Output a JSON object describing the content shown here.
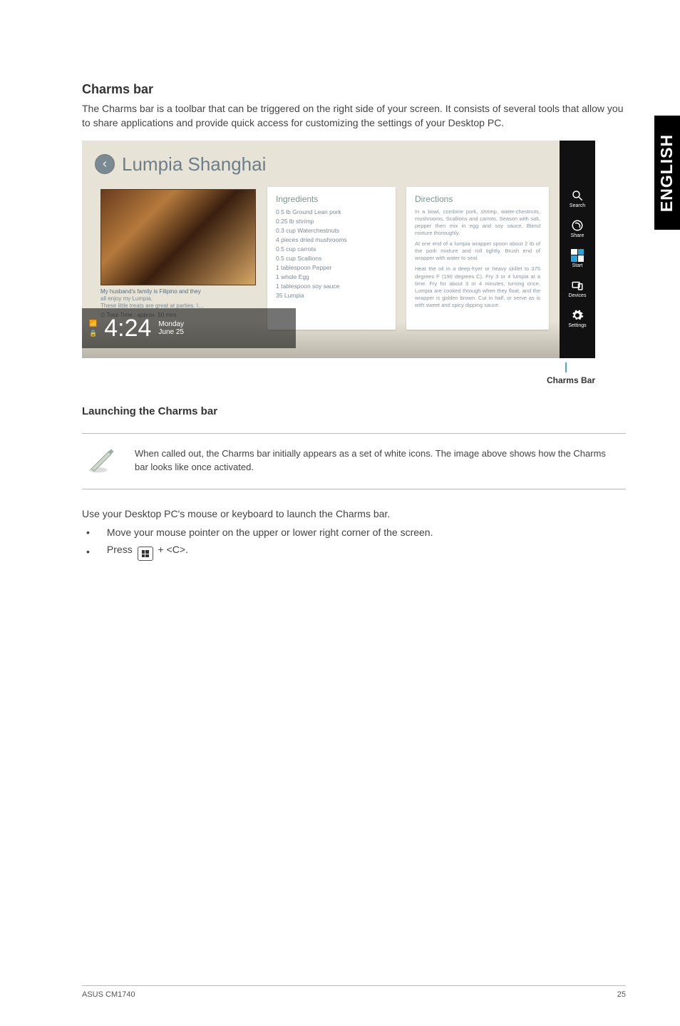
{
  "sideTab": "ENGLISH",
  "heading": "Charms bar",
  "intro": "The Charms bar is a toolbar that can be triggered on the right side of your screen. It consists of several tools that allow you to share applications and provide quick access for customizing the settings of your Desktop PC.",
  "screenshot": {
    "appTitle": "Lumpia Shanghai",
    "caption": {
      "l1": "My husband's family is Filipino and they",
      "l2": "all enjoy my Lumpia.",
      "l3": "These little treats are great at parties. I…",
      "l4": "Total Time : approx. 50 mns"
    },
    "time": "4:24",
    "day": "Monday",
    "date": "June 25",
    "ingredientsTitle": "Ingredients",
    "ingredients": [
      "0.5 lb Ground Lean pork",
      "0.25 lb shrimp",
      "0.3 cup Waterchestnuts",
      "4 pieces dried mushrooms",
      "0.5 cup carrots",
      "0.5 cup Scallions",
      "1 tablespoon Pepper",
      "1 whole Egg",
      "1 tablespoon soy sauce",
      "35 Lumpia"
    ],
    "directionsTitle": "Directions",
    "directions": [
      "In a bowl, combine pork, shrimp, water-chestnuts, mushrooms, Scallions and carrots. Season with salt, pepper then mix in egg and soy sauce. Blend mixture thoroughly.",
      "At one end of a lumpia wrapper spoon about 2 tb of the pork mixture and roll tightly. Brush end of wrapper with water to seal.",
      "Heat the oil in a deep-fryer or heavy skillet to 375 degrees F (190 degrees C). Fry 3 or 4 lumpia at a time. Fry for about 3 or 4 minutes, turning once. Lumpia are cooked through when they float, and the wrapper is golden brown. Cut in half, or serve as is with sweet and spicy dipping sauce."
    ],
    "charms": {
      "search": "Search",
      "share": "Share",
      "start": "Start",
      "devices": "Devices",
      "settings": "Settings"
    }
  },
  "screenshotLabel": "Charms Bar",
  "launchHeading": "Launching the Charms bar",
  "note": "When called out, the Charms bar initially appears as a set of white icons. The image above shows how the Charms bar looks like once activated.",
  "useText": "Use your Desktop PC's mouse or keyboard to launch the Charms bar.",
  "step1": "Move your mouse pointer on the upper or lower right corner of the screen.",
  "step2a": "Press ",
  "step2b": " + <C>.",
  "footerLeft": "ASUS CM1740",
  "footerRight": "25"
}
